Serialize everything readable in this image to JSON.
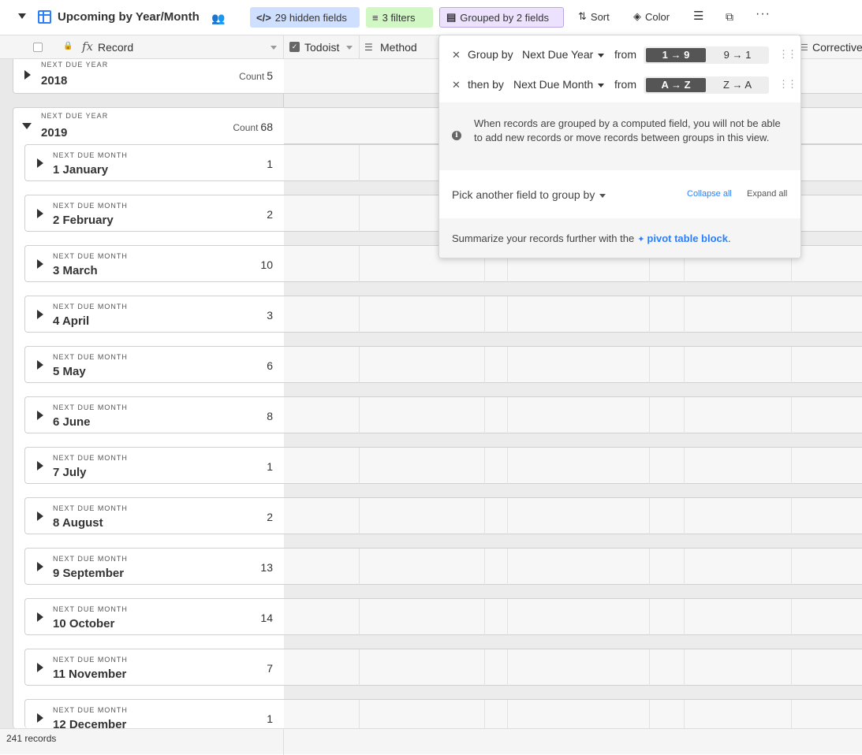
{
  "toolbar": {
    "view_title": "Upcoming by Year/Month",
    "hidden_fields_label": "29 hidden fields",
    "filters_label": "3 filters",
    "grouped_label": "Grouped by 2 fields",
    "sort_label": "Sort",
    "color_label": "Color"
  },
  "header": {
    "record_label": "Record",
    "todoist_label": "Todoist",
    "method_label": "Method",
    "corrective_label": "Corrective"
  },
  "groups": {
    "year_label": "NEXT DUE YEAR",
    "month_label": "NEXT DUE MONTH",
    "count_label": "Count",
    "y2018": {
      "value": "2018",
      "count": "5"
    },
    "y2019": {
      "value": "2019",
      "count": "68"
    },
    "months": [
      {
        "value": "1 January",
        "count": "1"
      },
      {
        "value": "2 February",
        "count": "2"
      },
      {
        "value": "3 March",
        "count": "10"
      },
      {
        "value": "4 April",
        "count": "3"
      },
      {
        "value": "5 May",
        "count": "6"
      },
      {
        "value": "6 June",
        "count": "8"
      },
      {
        "value": "7 July",
        "count": "1"
      },
      {
        "value": "8 August",
        "count": "2"
      },
      {
        "value": "9 September",
        "count": "13"
      },
      {
        "value": "10 October",
        "count": "14"
      },
      {
        "value": "11 November",
        "count": "7"
      },
      {
        "value": "12 December",
        "count": "1"
      }
    ]
  },
  "footer": {
    "records_label": "241 records"
  },
  "popover": {
    "row1": {
      "label": "Group by",
      "field": "Next Due Year",
      "from": "from",
      "opt_on": "1 → 9",
      "opt_off": "9 → 1"
    },
    "row2": {
      "label": "then by",
      "field": "Next Due Month",
      "from": "from",
      "opt_on": "A → Z",
      "opt_off": "Z → A"
    },
    "info": "When records are grouped by a computed field, you will not be able to add new records or move records between groups in this view.",
    "pick_label": "Pick another field to group by",
    "collapse_all": "Collapse all",
    "expand_all": "Expand all",
    "summary_prefix": "Summarize your records further with the",
    "summary_link": "pivot table block",
    "summary_suffix": "."
  },
  "colors": {
    "accent": "#2d7ff9",
    "hidden_pill": "#cfdfff",
    "filter_pill": "#d1f7c4",
    "group_pill": "#ede2fe"
  }
}
